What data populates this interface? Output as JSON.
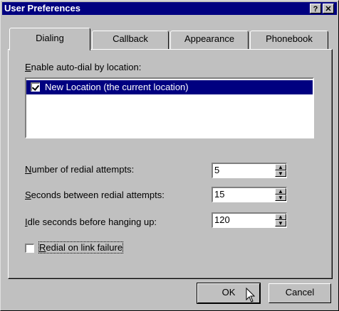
{
  "window": {
    "title": "User Preferences",
    "help_glyph": "?",
    "close_glyph": "✕"
  },
  "tabs": [
    {
      "label": "Dialing",
      "active": true
    },
    {
      "label": "Callback",
      "active": false
    },
    {
      "label": "Appearance",
      "active": false
    },
    {
      "label": "Phonebook",
      "active": false
    }
  ],
  "dialing": {
    "autodial_label_prefix": "E",
    "autodial_label_rest": "nable auto-dial by location:",
    "locations": [
      {
        "label": "New Location (the current location)",
        "checked": true,
        "selected": true
      }
    ],
    "redial_attempts": {
      "label_prefix": "N",
      "label_rest": "umber of redial attempts:",
      "value": "5"
    },
    "seconds_between": {
      "label_prefix": "S",
      "label_rest": "econds between redial attempts:",
      "value": "15"
    },
    "idle_seconds": {
      "label_prefix": "I",
      "label_rest": "dle seconds before hanging up:",
      "value": "120"
    },
    "redial_on_failure": {
      "label_prefix": "R",
      "label_rest": "edial on link failure",
      "checked": false
    }
  },
  "buttons": {
    "ok": "OK",
    "cancel": "Cancel"
  },
  "colors": {
    "face": "#c0c0c0",
    "titlebar": "#000080",
    "selection": "#000080"
  }
}
